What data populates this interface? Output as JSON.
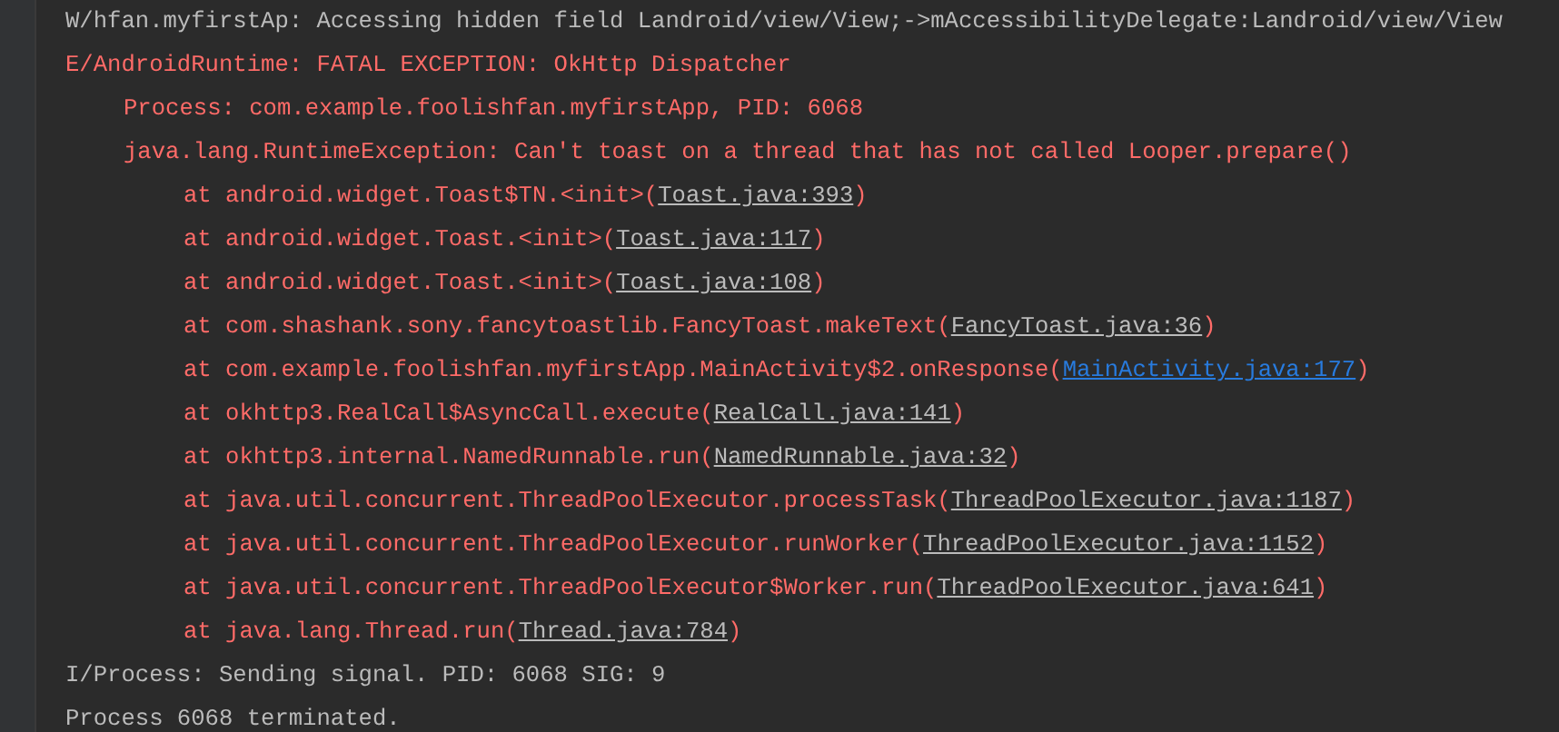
{
  "log": [
    {
      "kind": "warning",
      "text": "W/hfan.myfirstAp: Accessing hidden field Landroid/view/View;->mAccessibilityDelegate:Landroid/view/View"
    },
    {
      "kind": "error",
      "text": "E/AndroidRuntime: FATAL EXCEPTION: OkHttp Dispatcher",
      "children": [
        {
          "kind": "error",
          "text": "Process: com.example.foolishfan.myfirstApp, PID: 6068"
        },
        {
          "kind": "error",
          "text": "java.lang.RuntimeException: Can't toast on a thread that has not called Looper.prepare()",
          "children": [
            {
              "kind": "error",
              "text": "at android.widget.Toast$TN.<init>(",
              "link": "Toast.java:393",
              "in_project": false,
              "after": ")"
            },
            {
              "kind": "error",
              "text": "at android.widget.Toast.<init>(",
              "link": "Toast.java:117",
              "in_project": false,
              "after": ")"
            },
            {
              "kind": "error",
              "text": "at android.widget.Toast.<init>(",
              "link": "Toast.java:108",
              "in_project": false,
              "after": ")"
            },
            {
              "kind": "error",
              "text": "at com.shashank.sony.fancytoastlib.FancyToast.makeText(",
              "link": "FancyToast.java:36",
              "in_project": false,
              "after": ")"
            },
            {
              "kind": "error",
              "text": "at com.example.foolishfan.myfirstApp.MainActivity$2.onResponse(",
              "link": "MainActivity.java:177",
              "in_project": true,
              "after": ")"
            },
            {
              "kind": "error",
              "text": "at okhttp3.RealCall$AsyncCall.execute(",
              "link": "RealCall.java:141",
              "in_project": false,
              "after": ")"
            },
            {
              "kind": "error",
              "text": "at okhttp3.internal.NamedRunnable.run(",
              "link": "NamedRunnable.java:32",
              "in_project": false,
              "after": ")"
            },
            {
              "kind": "error",
              "text": "at java.util.concurrent.ThreadPoolExecutor.processTask(",
              "link": "ThreadPoolExecutor.java:1187",
              "in_project": false,
              "after": ")"
            },
            {
              "kind": "error",
              "text": "at java.util.concurrent.ThreadPoolExecutor.runWorker(",
              "link": "ThreadPoolExecutor.java:1152",
              "in_project": false,
              "after": ")"
            },
            {
              "kind": "error",
              "text": "at java.util.concurrent.ThreadPoolExecutor$Worker.run(",
              "link": "ThreadPoolExecutor.java:641",
              "in_project": false,
              "after": ")"
            },
            {
              "kind": "error",
              "text": "at java.lang.Thread.run(",
              "link": "Thread.java:784",
              "in_project": false,
              "after": ")"
            }
          ]
        }
      ]
    },
    {
      "kind": "info",
      "text": "I/Process: Sending signal. PID: 6068 SIG: 9"
    },
    {
      "kind": "info",
      "text": "Process 6068 terminated."
    }
  ]
}
